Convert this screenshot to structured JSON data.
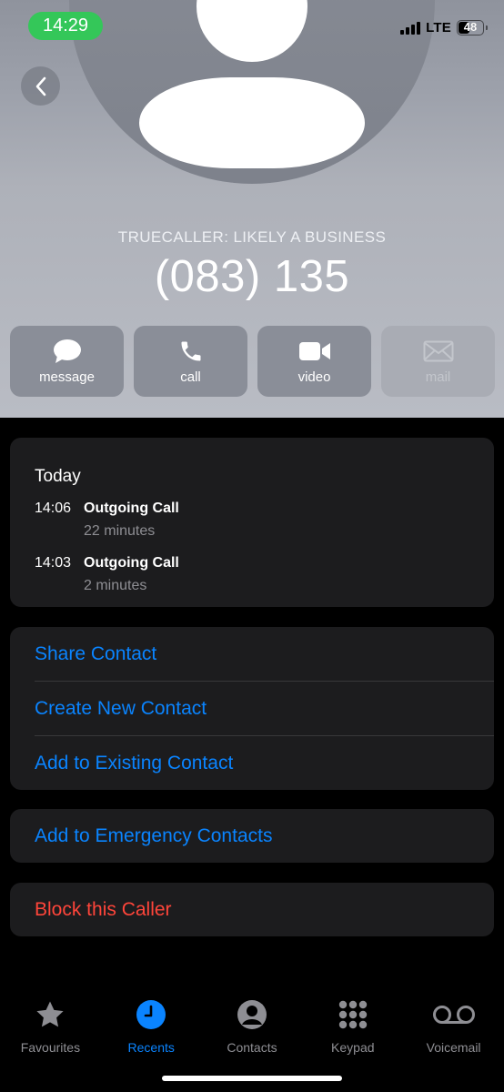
{
  "status_bar": {
    "time": "14:29",
    "network": "LTE",
    "battery": "48"
  },
  "header": {
    "subtitle": "TRUECALLER: LIKELY A BUSINESS",
    "number": "(083) 135"
  },
  "actions": [
    {
      "label": "message",
      "icon": "message-bubble-icon"
    },
    {
      "label": "call",
      "icon": "phone-icon"
    },
    {
      "label": "video",
      "icon": "video-camera-icon"
    },
    {
      "label": "mail",
      "icon": "envelope-icon",
      "disabled": true
    }
  ],
  "recents": {
    "day": "Today",
    "calls": [
      {
        "time": "14:06",
        "type": "Outgoing Call",
        "duration": "22 minutes"
      },
      {
        "time": "14:03",
        "type": "Outgoing Call",
        "duration": "2 minutes"
      }
    ]
  },
  "options": [
    {
      "label": "Share Contact"
    },
    {
      "label": "Create New Contact"
    },
    {
      "label": "Add to Existing Contact"
    }
  ],
  "emergency": {
    "label": "Add to Emergency Contacts"
  },
  "block": {
    "label": "Block this Caller"
  },
  "tabs": [
    {
      "label": "Favourites",
      "icon": "star-icon"
    },
    {
      "label": "Recents",
      "icon": "clock-icon",
      "active": true
    },
    {
      "label": "Contacts",
      "icon": "person-circle-icon"
    },
    {
      "label": "Keypad",
      "icon": "keypad-icon"
    },
    {
      "label": "Voicemail",
      "icon": "voicemail-icon"
    }
  ],
  "colors": {
    "accent": "#0a84ff",
    "destructive": "#ff453a",
    "status_green": "#34c759",
    "card_bg": "#1c1c1e"
  }
}
